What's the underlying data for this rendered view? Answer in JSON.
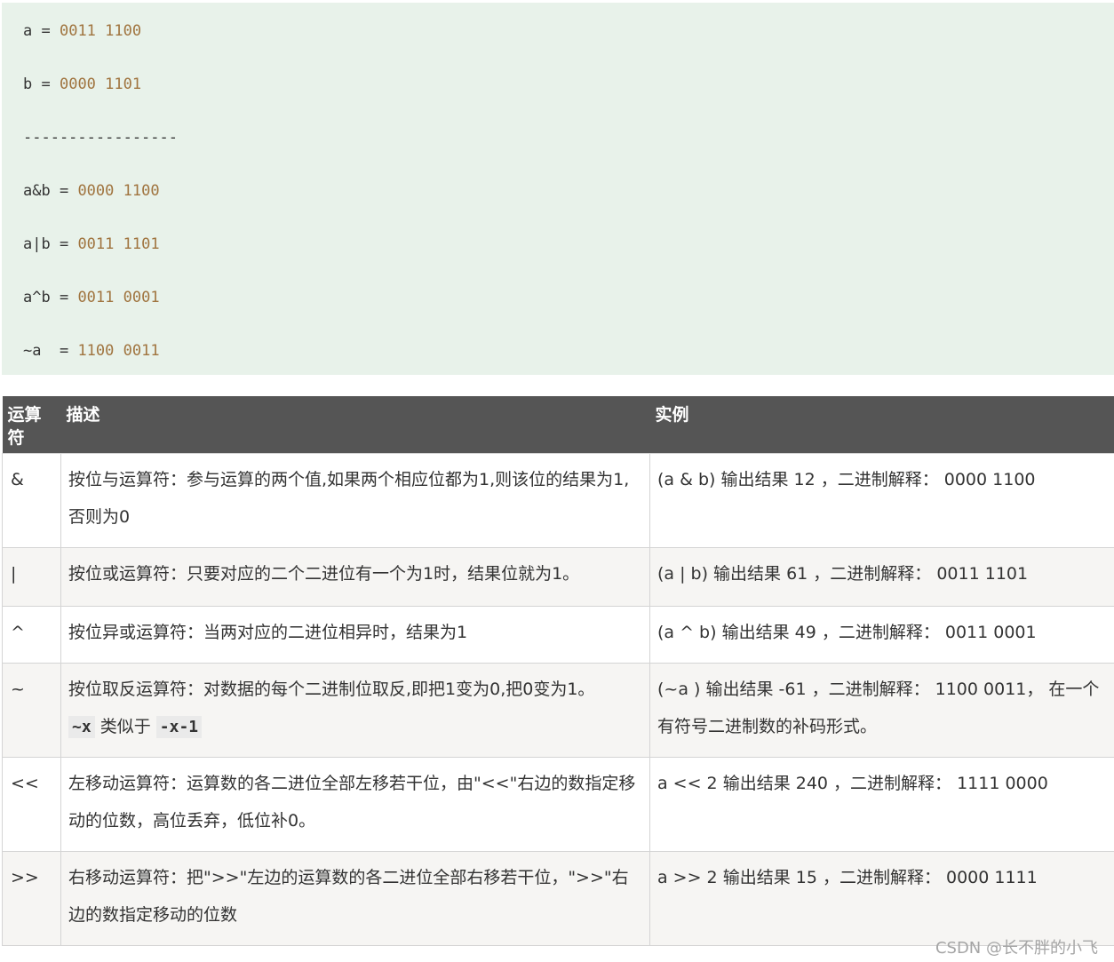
{
  "code_block": {
    "lines": [
      {
        "lhs": "a",
        "eq": " = ",
        "val": "0011 1100"
      },
      {
        "lhs": "b",
        "eq": " = ",
        "val": "0000 1101"
      },
      {
        "lhs": "-----------------",
        "eq": "",
        "val": ""
      },
      {
        "lhs": "a&b",
        "eq": " = ",
        "val": "0000 1100"
      },
      {
        "lhs": "a|b",
        "eq": " = ",
        "val": "0011 1101"
      },
      {
        "lhs": "a^b",
        "eq": " = ",
        "val": "0011 0001"
      },
      {
        "lhs": "~a ",
        "eq": " = ",
        "val": "1100 0011"
      }
    ]
  },
  "table": {
    "headers": [
      "运算符",
      "描述",
      "实例"
    ],
    "rows": [
      {
        "op": "&",
        "desc": "按位与运算符：参与运算的两个值,如果两个相应位都为1,则该位的结果为1,否则为0",
        "example": "(a & b) 输出结果 12 ，二进制解释： 0000 1100"
      },
      {
        "op": "|",
        "desc": "按位或运算符：只要对应的二个二进位有一个为1时，结果位就为1。",
        "example": "(a | b) 输出结果 61 ，二进制解释： 0011 1101"
      },
      {
        "op": "^",
        "desc": "按位异或运算符：当两对应的二进位相异时，结果为1",
        "example": "(a ^ b) 输出结果 49 ，二进制解释： 0011 0001"
      },
      {
        "op": "~",
        "desc": "按位取反运算符：对数据的每个二进制位取反,即把1变为0,把0变为1。",
        "desc_code1": "~x",
        "desc_mid": " 类似于 ",
        "desc_code2": "-x-1",
        "example": "(~a ) 输出结果 -61 ，二进制解释： 1100 0011， 在一个有符号二进制数的补码形式。"
      },
      {
        "op": "<<",
        "desc": "左移动运算符：运算数的各二进位全部左移若干位，由\"<<\"右边的数指定移动的位数，高位丢弃，低位补0。",
        "example": "a << 2 输出结果 240 ，二进制解释： 1111 0000"
      },
      {
        "op": ">>",
        "desc": "右移动运算符：把\">>\"左边的运算数的各二进位全部右移若干位，\">>\"右边的数指定移动的位数",
        "example": "a >> 2 输出结果 15 ，二进制解释： 0000 1111"
      }
    ]
  },
  "watermark": "CSDN @长不胖的小飞"
}
